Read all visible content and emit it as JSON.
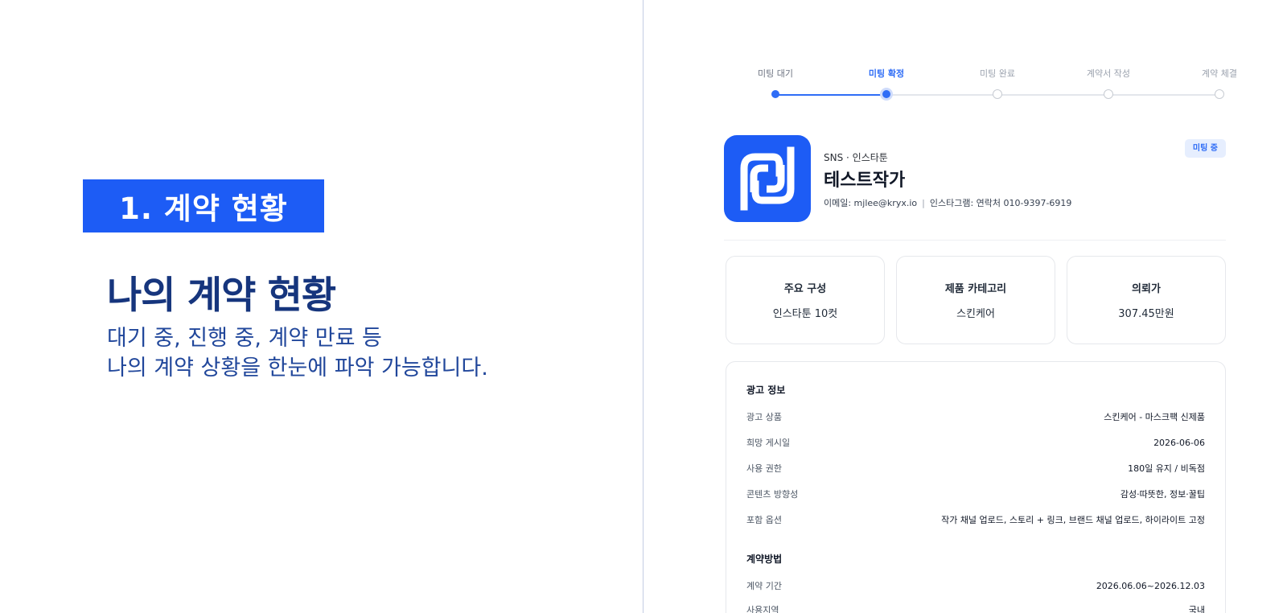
{
  "promo": {
    "section_badge": "1. 계약 현황",
    "title": "나의 계약 현황",
    "desc_line1": "대기 중, 진행 중, 계약 만료 등",
    "desc_line2": "나의 계약 상황을 한눈에 파악 가능합니다."
  },
  "stepper": {
    "progress_fraction": 0.25,
    "steps": [
      {
        "label": "미팅 대기",
        "state": "done"
      },
      {
        "label": "미팅 확정",
        "state": "active"
      },
      {
        "label": "미팅 완료",
        "state": "pending"
      },
      {
        "label": "계약서 작성",
        "state": "pending"
      },
      {
        "label": "계약 체결",
        "state": "pending"
      }
    ]
  },
  "profile": {
    "logo_icon": "pd-logo-icon",
    "category": "SNS · 인스타툰",
    "name": "테스트작가",
    "email": "이메일: mjlee@kryx.io",
    "separator": "|",
    "instagram": "인스타그램: 연락처 010-9397-6919",
    "status": "미팅 중"
  },
  "summary_cards": [
    {
      "label": "주요 구성",
      "value": "인스타툰 10컷"
    },
    {
      "label": "제품 카테고리",
      "value": "스킨케어"
    },
    {
      "label": "의뢰가",
      "value": "307.45만원"
    }
  ],
  "ad_info": {
    "title": "광고 정보",
    "rows": [
      {
        "label": "광고 상품",
        "value": "스킨케어 - 마스크팩 신제품"
      },
      {
        "label": "희망 게시일",
        "value": "2026-06-06"
      },
      {
        "label": "사용 권한",
        "value": "180일 유지 / 비독점"
      },
      {
        "label": "콘텐츠 방향성",
        "value": "감성·따뜻한, 정보·꿀팁"
      },
      {
        "label": "포함 옵션",
        "value": "작가 채널 업로드, 스토리 + 링크, 브랜드 채널 업로드, 하이라이트 고정"
      }
    ]
  },
  "contract_method": {
    "title": "계약방법",
    "rows": [
      {
        "label": "계약 기간",
        "value": "2026.06.06~2026.12.03"
      },
      {
        "label": "사용지역",
        "value": "국내"
      }
    ]
  },
  "colors": {
    "brand_blue": "#1d5cf5",
    "accent_blue": "#2f6df6",
    "title_navy": "#16357d"
  }
}
